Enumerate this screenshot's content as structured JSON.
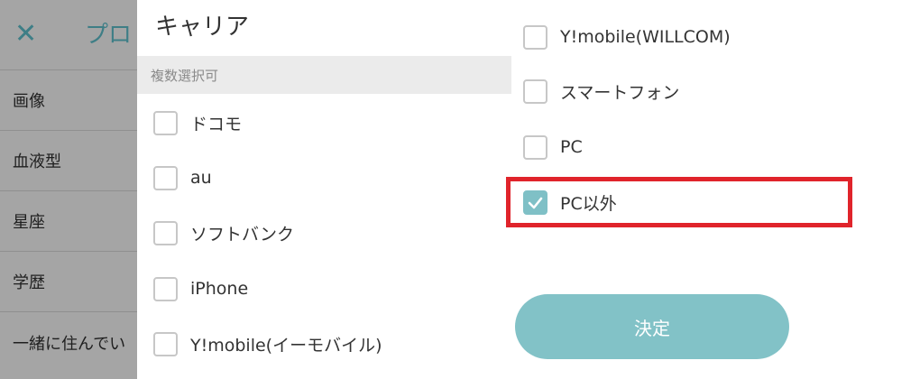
{
  "background": {
    "title": "プロ",
    "rows": [
      "画像",
      "血液型",
      "星座",
      "学歴",
      "一緒に住んでい"
    ]
  },
  "dialog": {
    "title": "キャリア",
    "subtitle": "複数選択可",
    "options_left": [
      {
        "label": "ドコモ",
        "checked": false
      },
      {
        "label": "au",
        "checked": false
      },
      {
        "label": "ソフトバンク",
        "checked": false
      },
      {
        "label": "iPhone",
        "checked": false
      },
      {
        "label": "Y!mobile(イーモバイル)",
        "checked": false
      }
    ],
    "options_right": [
      {
        "label": "Y!mobile(WILLCOM)",
        "checked": false
      },
      {
        "label": "スマートフォン",
        "checked": false
      },
      {
        "label": "PC",
        "checked": false
      },
      {
        "label": "PC以外",
        "checked": true
      }
    ],
    "confirm_label": "決定"
  },
  "colors": {
    "accent": "#82c2c7",
    "highlight": "#e0242b",
    "overlay": "#a5a5a5"
  }
}
